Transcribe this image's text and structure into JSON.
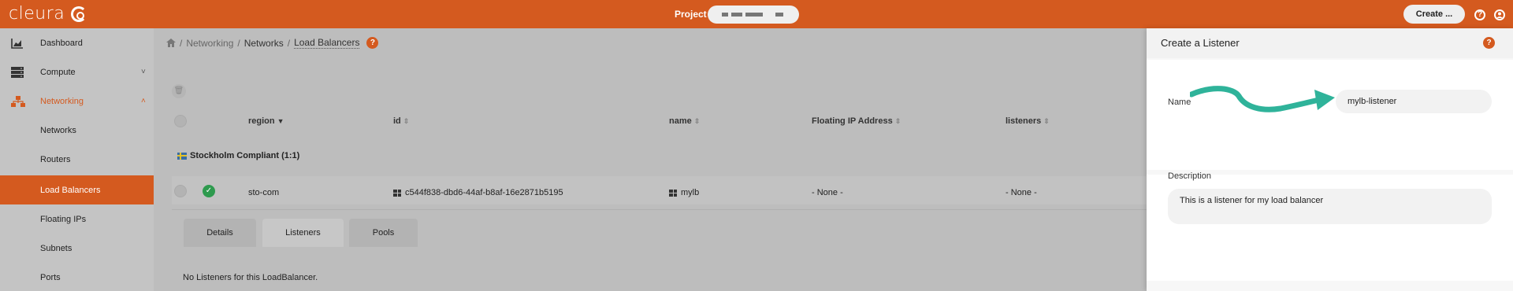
{
  "header": {
    "logo_text": "cleura",
    "project_label": "Project",
    "create_label": "Create ...",
    "help_icon": "help-icon",
    "user_icon": "user-icon",
    "accent": "#d45a1f"
  },
  "sidebar": {
    "items": [
      {
        "label": "Dashboard",
        "icon": "chart-icon"
      },
      {
        "label": "Compute",
        "icon": "server-icon",
        "chevron": "˅"
      },
      {
        "label": "Networking",
        "icon": "network-icon",
        "chevron": "˄"
      },
      {
        "label": "Networks"
      },
      {
        "label": "Routers"
      },
      {
        "label": "Load Balancers"
      },
      {
        "label": "Floating IPs"
      },
      {
        "label": "Subnets"
      },
      {
        "label": "Ports"
      }
    ]
  },
  "breadcrumb": {
    "home_icon": "home-icon",
    "items": [
      "Networking",
      "Networks",
      "Load Balancers"
    ],
    "sep": "/"
  },
  "table": {
    "columns": [
      "region",
      "id",
      "name",
      "Floating IP Address",
      "listeners"
    ],
    "group": "Stockholm Compliant (1:1)",
    "row": {
      "region": "sto-com",
      "id": "c544f838-dbd6-44af-b8af-16e2871b5195",
      "name": "mylb",
      "floating_ip": "- None -",
      "listeners": "- None -"
    }
  },
  "details": {
    "tabs": [
      "Details",
      "Listeners",
      "Pools"
    ],
    "active_tab": "Listeners",
    "empty_text": "No Listeners for this LoadBalancer."
  },
  "panel": {
    "title": "Create a Listener",
    "name_label": "Name",
    "name_value": "mylb-listener",
    "description_label": "Description",
    "description_value": "This is a listener for my load balancer"
  }
}
